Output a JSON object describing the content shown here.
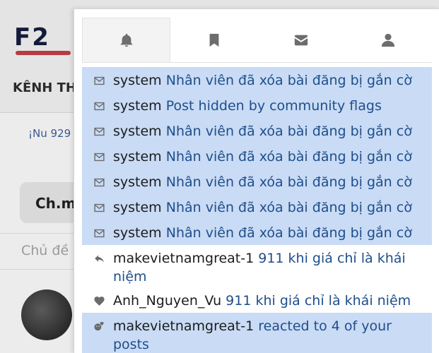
{
  "background": {
    "logo_text": "F2",
    "channel_label": "KÊNH TH",
    "balance_text": "¡Nu 929",
    "card_text": "Ch.m",
    "input_placeholder": "Chủ đề"
  },
  "tabs": [
    {
      "name": "notifications",
      "icon": "bell-icon",
      "active": true
    },
    {
      "name": "bookmarks",
      "icon": "bookmark-icon",
      "active": false
    },
    {
      "name": "messages",
      "icon": "envelope-icon",
      "active": false
    },
    {
      "name": "profile",
      "icon": "user-icon",
      "active": false
    }
  ],
  "notifications": [
    {
      "icon": "envelope-icon",
      "user": "system",
      "text": "Nhân viên đã xóa bài đăng bị gắn cờ",
      "unread": true
    },
    {
      "icon": "envelope-icon",
      "user": "system",
      "text": "Post hidden by community flags",
      "unread": true
    },
    {
      "icon": "envelope-icon",
      "user": "system",
      "text": "Nhân viên đã xóa bài đăng bị gắn cờ",
      "unread": true
    },
    {
      "icon": "envelope-icon",
      "user": "system",
      "text": "Nhân viên đã xóa bài đăng bị gắn cờ",
      "unread": true
    },
    {
      "icon": "envelope-icon",
      "user": "system",
      "text": "Nhân viên đã xóa bài đăng bị gắn cờ",
      "unread": true
    },
    {
      "icon": "envelope-icon",
      "user": "system",
      "text": "Nhân viên đã xóa bài đăng bị gắn cờ",
      "unread": true
    },
    {
      "icon": "envelope-icon",
      "user": "system",
      "text": "Nhân viên đã xóa bài đăng bị gắn cờ",
      "unread": true
    },
    {
      "icon": "reply-icon",
      "user": "makevietnamgreat-1",
      "text": "911 khi giá chỉ là khái niệm",
      "unread": false
    },
    {
      "icon": "heart-icon",
      "user": "Anh_Nguyen_Vu",
      "text": "911 khi giá chỉ là khái niệm",
      "unread": false
    },
    {
      "icon": "reactions-icon",
      "user": "makevietnamgreat-1",
      "text": "reacted to 4 of your posts",
      "unread": true
    }
  ],
  "colors": {
    "unread_bg": "#c9dbf5",
    "link_blue": "#1f4e8a",
    "icon_gray": "#6b6b6b"
  }
}
